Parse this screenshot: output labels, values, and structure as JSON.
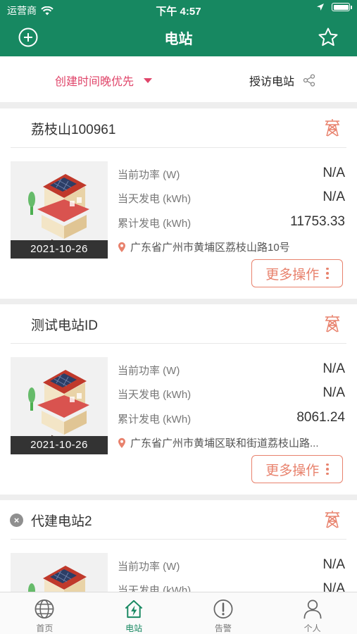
{
  "status_bar": {
    "carrier": "运营商",
    "time": "下午 4:57"
  },
  "nav": {
    "title": "电站"
  },
  "filter": {
    "sort_label": "创建时间晚优先",
    "visit_label": "授访电站"
  },
  "stations": [
    {
      "name": "荔枝山100961",
      "date": "2021-10-26",
      "power_label": "当前功率 (W)",
      "power_value": "N/A",
      "today_label": "当天发电 (kWh)",
      "today_value": "N/A",
      "total_label": "累计发电 (kWh)",
      "total_value": "11753.33",
      "address": "广东省广州市黄埔区荔枝山路10号",
      "more_label": "更多操作"
    },
    {
      "name": "测试电站ID",
      "date": "2021-10-26",
      "power_label": "当前功率 (W)",
      "power_value": "N/A",
      "today_label": "当天发电 (kWh)",
      "today_value": "N/A",
      "total_label": "累计发电 (kWh)",
      "total_value": "8061.24",
      "address": "广东省广州市黄埔区联和街道荔枝山路...",
      "more_label": "更多操作"
    },
    {
      "name": "代建电站2",
      "power_label": "当前功率 (W)",
      "power_value": "N/A",
      "today_label": "当天发电 (kWh)",
      "today_value": "N/A"
    }
  ],
  "tabs": [
    {
      "label": "首页",
      "icon": "globe-icon"
    },
    {
      "label": "电站",
      "icon": "house-bolt-icon",
      "active": true
    },
    {
      "label": "告警",
      "icon": "alert-icon"
    },
    {
      "label": "个人",
      "icon": "person-icon"
    }
  ],
  "colors": {
    "brand": "#178861",
    "accent": "#e0456a",
    "action": "#e8826d"
  }
}
